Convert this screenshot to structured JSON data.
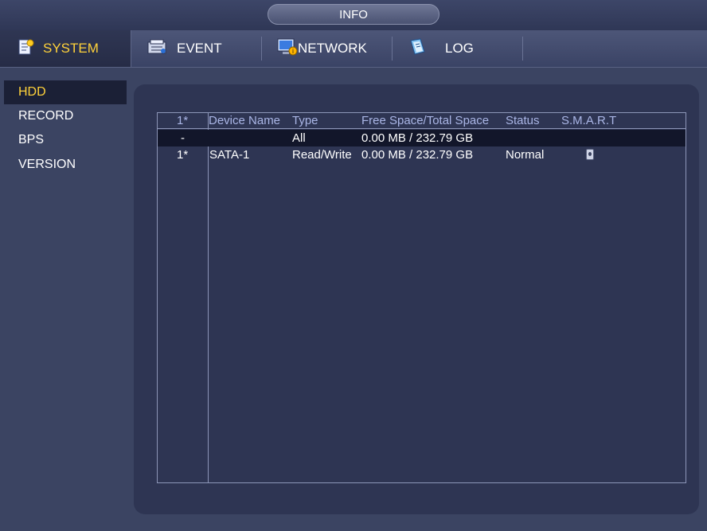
{
  "window": {
    "title": "INFO"
  },
  "tabs": [
    {
      "label": "SYSTEM",
      "icon": "system-doc-icon",
      "active": true
    },
    {
      "label": "EVENT",
      "icon": "event-icon",
      "active": false
    },
    {
      "label": "NETWORK",
      "icon": "network-icon",
      "active": false
    },
    {
      "label": "LOG",
      "icon": "log-book-icon",
      "active": false
    }
  ],
  "sidebar": {
    "items": [
      {
        "label": "HDD",
        "active": true
      },
      {
        "label": "RECORD",
        "active": false
      },
      {
        "label": "BPS",
        "active": false
      },
      {
        "label": "VERSION",
        "active": false
      }
    ]
  },
  "hdd_table": {
    "columns": [
      "1*",
      "Device Name",
      "Type",
      "Free Space/Total Space",
      "Status",
      "S.M.A.R.T"
    ],
    "rows": [
      {
        "index": "-",
        "device": "",
        "type": "All",
        "space": "0.00 MB / 232.79 GB",
        "status": "",
        "smart": ""
      },
      {
        "index": "1*",
        "device": "SATA-1",
        "type": "Read/Write",
        "space": "0.00 MB / 232.79 GB",
        "status": "Normal",
        "smart": "smart-detail-icon"
      }
    ]
  },
  "colors": {
    "accent_active": "#ffd23a",
    "header_text": "#aab6e6",
    "panel_bg": "#2e3553",
    "background": "#3b4462"
  }
}
